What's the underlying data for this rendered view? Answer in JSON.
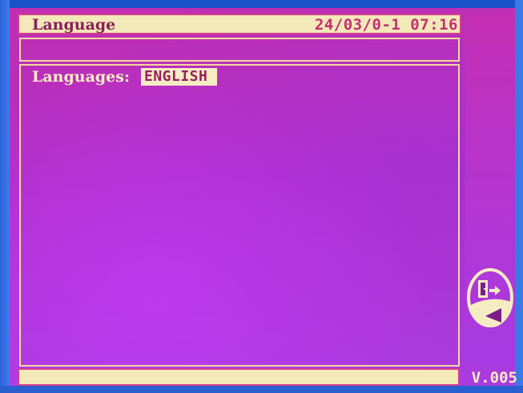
{
  "header": {
    "title": "Language",
    "datetime": "24/03/0-1 07:16"
  },
  "settings": {
    "language_label": "Languages:",
    "language_value": "ENGLISH"
  },
  "sidebar": {
    "exit_icon": "exit-door-icon"
  },
  "footer": {
    "version": "V.005"
  },
  "colors": {
    "background": "#b530c6",
    "panel_fill": "#f2e8b8",
    "panel_border": "#d43d8e",
    "text_light": "#f6ecc2",
    "text_dark": "#8a1f5a"
  }
}
